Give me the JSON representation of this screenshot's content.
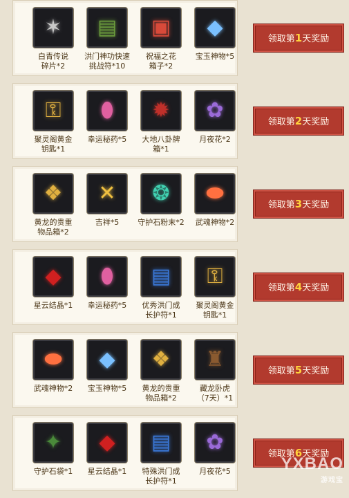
{
  "rows": [
    {
      "button": {
        "prefix": "领取第",
        "day": "1",
        "suffix": "天奖励"
      },
      "items": [
        {
          "label": "白青传说\n碎片*2",
          "icon": "shard-icon",
          "color": "#c8c8c8",
          "glyph": "✶"
        },
        {
          "label": "洪门神功快速\n挑战符*10",
          "icon": "talisman-icon",
          "color": "#6a9a3c",
          "glyph": "▤"
        },
        {
          "label": "祝福之花\n箱子*2",
          "icon": "flower-box-icon",
          "color": "#d84a3a",
          "glyph": "▣"
        },
        {
          "label": "宝玉神物*5",
          "icon": "jade-icon",
          "color": "#7ac0ff",
          "glyph": "◆"
        }
      ]
    },
    {
      "button": {
        "prefix": "领取第",
        "day": "2",
        "suffix": "天奖励"
      },
      "items": [
        {
          "label": "聚灵阁黄金\n钥匙*1",
          "icon": "gold-key-icon",
          "color": "#e0b040",
          "glyph": "⚿"
        },
        {
          "label": "幸运秘药*5",
          "icon": "potion-jar-icon",
          "color": "#e060a0",
          "glyph": "⬮"
        },
        {
          "label": "大地八卦牌\n箱*1",
          "icon": "bagua-chest-icon",
          "color": "#c0302a",
          "glyph": "✹"
        },
        {
          "label": "月夜花*2",
          "icon": "purple-flower-icon",
          "color": "#9a6ad8",
          "glyph": "✿"
        }
      ]
    },
    {
      "button": {
        "prefix": "领取第",
        "day": "3",
        "suffix": "天奖励"
      },
      "items": [
        {
          "label": "黄龙的贵重\n物品箱*2",
          "icon": "dragon-chest-icon",
          "color": "#e0b040",
          "glyph": "❖"
        },
        {
          "label": "吉祥*5",
          "icon": "lucky-charm-icon",
          "color": "#f0c040",
          "glyph": "✕"
        },
        {
          "label": "守护石粉末*2",
          "icon": "powder-icon",
          "color": "#40d0b0",
          "glyph": "❂"
        },
        {
          "label": "武魂神物*2",
          "icon": "soul-relic-icon",
          "color": "#ff7040",
          "glyph": "⬬"
        }
      ]
    },
    {
      "button": {
        "prefix": "领取第",
        "day": "4",
        "suffix": "天奖励"
      },
      "items": [
        {
          "label": "星云结晶*1",
          "icon": "red-crystal-icon",
          "color": "#d02020",
          "glyph": "◆"
        },
        {
          "label": "幸运秘药*5",
          "icon": "potion-jar-icon",
          "color": "#e060a0",
          "glyph": "⬮"
        },
        {
          "label": "优秀洪门成\n长护符*1",
          "icon": "blue-talisman-icon",
          "color": "#3a78d8",
          "glyph": "▤"
        },
        {
          "label": "聚灵阁黄金\n钥匙*1",
          "icon": "gold-key-icon",
          "color": "#e0b040",
          "glyph": "⚿"
        }
      ]
    },
    {
      "button": {
        "prefix": "领取第",
        "day": "5",
        "suffix": "天奖励"
      },
      "items": [
        {
          "label": "武魂神物*2",
          "icon": "soul-relic-icon",
          "color": "#ff7040",
          "glyph": "⬬"
        },
        {
          "label": "宝玉神物*5",
          "icon": "jade-icon",
          "color": "#7ac0ff",
          "glyph": "◆"
        },
        {
          "label": "黄龙的贵重\n物品箱*2",
          "icon": "dragon-chest-icon",
          "color": "#e0b040",
          "glyph": "❖"
        },
        {
          "label": "藏龙卧虎\n（7天）*1",
          "icon": "costume-icon",
          "color": "#8a5a30",
          "glyph": "♜"
        }
      ]
    },
    {
      "button": {
        "prefix": "领取第",
        "day": "6",
        "suffix": "天奖励"
      },
      "items": [
        {
          "label": "守护石袋*1",
          "icon": "stone-bag-icon",
          "color": "#4a8a3a",
          "glyph": "✦"
        },
        {
          "label": "星云结晶*1",
          "icon": "red-crystal-icon",
          "color": "#d02020",
          "glyph": "◆"
        },
        {
          "label": "特殊洪门成\n长护符*1",
          "icon": "blue-talisman-icon",
          "color": "#3a78d8",
          "glyph": "▤"
        },
        {
          "label": "月夜花*5",
          "icon": "purple-flower-icon",
          "color": "#9a6ad8",
          "glyph": "✿"
        }
      ]
    }
  ],
  "watermark": {
    "text": "YXBAO",
    "sub": "游戏宝"
  }
}
